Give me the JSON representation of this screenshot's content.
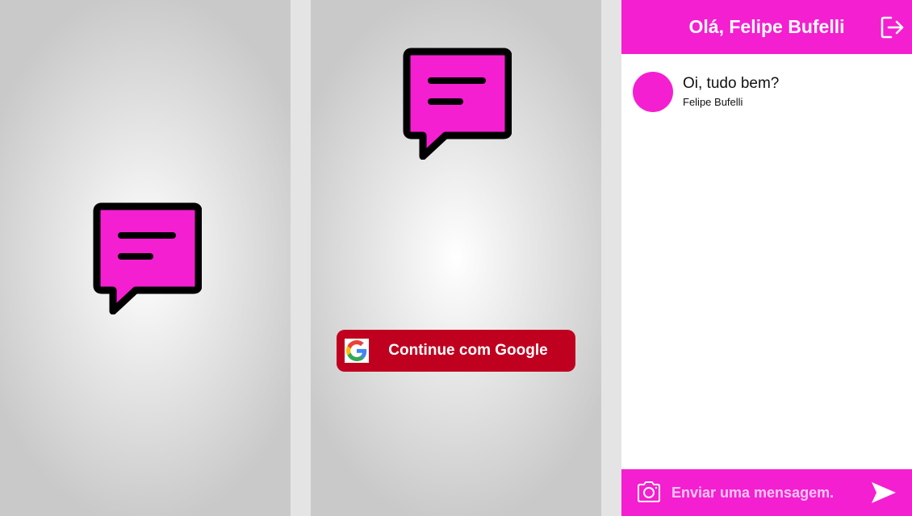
{
  "colors": {
    "brand_pink": "#f41fd0",
    "google_button_red": "#c0001f",
    "icon_outline": "#000000"
  },
  "splash": {
    "logo_icon": "chat-bubble-icon"
  },
  "login": {
    "logo_icon": "chat-bubble-icon",
    "google_button_label": "Continue com Google",
    "google_icon": "google-g-icon"
  },
  "chat": {
    "header_title": "Olá, Felipe Bufelli",
    "logout_icon": "logout-icon",
    "messages": [
      {
        "text": "Oi, tudo bem?",
        "author": "Felipe Bufelli"
      }
    ],
    "composer": {
      "camera_icon": "camera-icon",
      "placeholder": "Enviar uma mensagem.",
      "value": "",
      "send_icon": "send-icon"
    }
  }
}
